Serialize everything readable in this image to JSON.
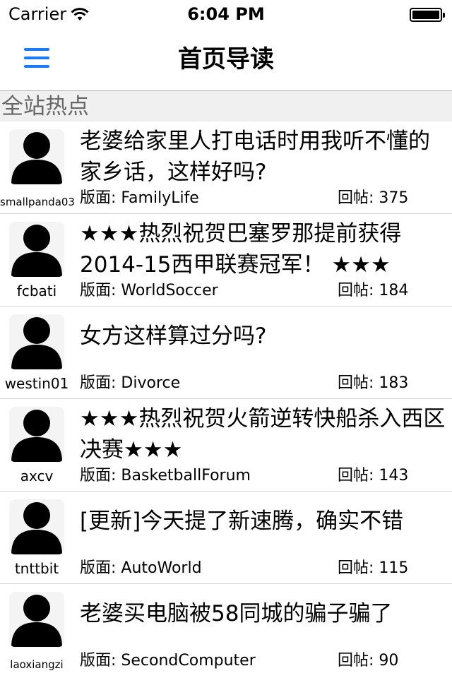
{
  "status_bar": {
    "carrier": "Carrier",
    "time": "6:04 PM",
    "wifi_icon": "wifi-icon",
    "battery_icon": "battery-full-icon"
  },
  "nav": {
    "menu_icon": "hamburger-menu-icon",
    "accent_color": "#1a7cf5",
    "title": "首页导读"
  },
  "section": {
    "title": "全站热点"
  },
  "posts": [
    {
      "username": "smallpanda03",
      "title": "老婆给家里人打电话时用我听不懂的家乡话，这样好吗?",
      "board": "版面: FamilyLife",
      "replies": "回帖: 375"
    },
    {
      "username": "fcbati",
      "title": "★★★热烈祝贺巴塞罗那提前获得2014-15西甲联赛冠军！ ★★★",
      "board": "版面: WorldSoccer",
      "replies": "回帖: 184"
    },
    {
      "username": "westin01",
      "title": "女方这样算过分吗?",
      "board": "版面: Divorce",
      "replies": "回帖: 183"
    },
    {
      "username": "axcv",
      "title": "★★★热烈祝贺火箭逆转快船杀入西区决赛★★★",
      "board": "版面: BasketballForum",
      "replies": "回帖: 143"
    },
    {
      "username": "tnttbit",
      "title": "[更新]今天提了新速腾，确实不错",
      "board": "版面: AutoWorld",
      "replies": "回帖: 115"
    },
    {
      "username": "laoxiangzi",
      "title": "老婆买电脑被58同城的骗子骗了",
      "board": "版面: SecondComputer",
      "replies": "回帖: 90"
    }
  ]
}
